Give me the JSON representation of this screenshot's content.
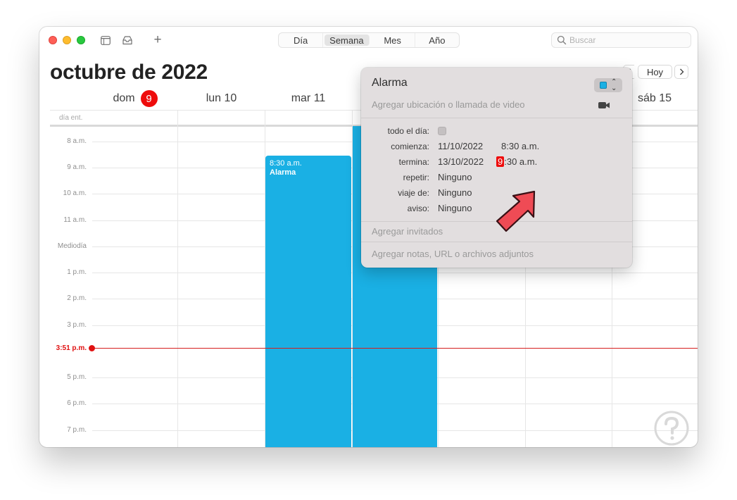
{
  "toolbar": {
    "views": [
      {
        "label": "Día",
        "active": false
      },
      {
        "label": "Semana",
        "active": true
      },
      {
        "label": "Mes",
        "active": false
      },
      {
        "label": "Año",
        "active": false
      }
    ],
    "search_placeholder": "Buscar",
    "icons": [
      "calendar-list-icon",
      "inbox-icon",
      "plus-icon",
      "search-icon"
    ]
  },
  "header": {
    "month_title": "octubre de 2022",
    "today_button": "Hoy",
    "prev_icon": "chevron-left-icon",
    "next_icon": "chevron-right-icon"
  },
  "days": [
    {
      "label": "dom",
      "number": "9",
      "today": true
    },
    {
      "label": "lun 10"
    },
    {
      "label": "mar 11"
    },
    {
      "label": "sáb 15"
    }
  ],
  "allday_label": "día ent.",
  "hours": [
    "8 a.m.",
    "9 a.m.",
    "10 a.m.",
    "11 a.m.",
    "Mediodía",
    "1 p.m.",
    "2 p.m.",
    "3 p.m.",
    "5 p.m.",
    "6 p.m.",
    "7 p.m."
  ],
  "now_label": "3:51 p.m.",
  "event": {
    "time": "8:30 a.m.",
    "title": "Alarma",
    "color": "#1ab0e4"
  },
  "popover": {
    "title": "Alarma",
    "location_placeholder": "Agregar ubicación o llamada de video",
    "allday_label": "todo el día:",
    "start_label": "comienza:",
    "start_date": "11/10/2022",
    "start_time": "8:30 a.m.",
    "end_label": "termina:",
    "end_date": "13/10/2022",
    "end_hour": "9",
    "end_rest": ":30 a.m.",
    "repeat_label": "repetir:",
    "repeat_value": "Ninguno",
    "travel_label": "viaje de:",
    "travel_value": "Ninguno",
    "alert_label": "aviso:",
    "alert_value": "Ninguno",
    "invitees_placeholder": "Agregar invitados",
    "notes_placeholder": "Agregar notas, URL o archivos adjuntos"
  },
  "colors": {
    "today_red": "#ee0c0c",
    "event_blue": "#1ab0e4",
    "now_red": "#e01010",
    "annotation_arrow": "#ef4b55"
  }
}
